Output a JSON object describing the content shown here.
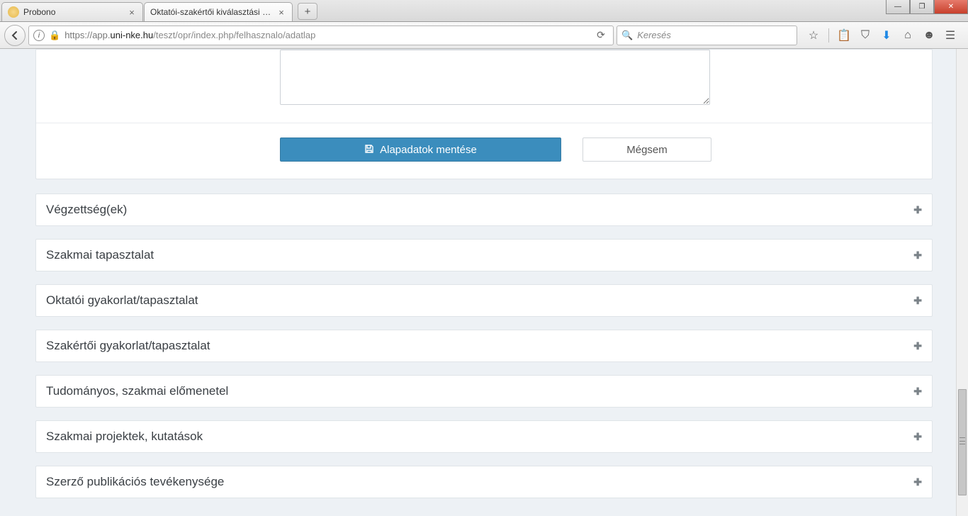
{
  "window": {
    "tabs": [
      {
        "title": "Probono",
        "favicon": "probono",
        "active": false
      },
      {
        "title": "Oktatói-szakértői kiválasztási re...",
        "favicon": "",
        "active": true
      }
    ]
  },
  "nav": {
    "url_secure_prefix": "https://app.",
    "url_domain": "uni-nke.hu",
    "url_path": "/teszt/opr/index.php/felhasznalo/adatlap",
    "search_placeholder": "Keresés"
  },
  "form": {
    "textarea_value": "",
    "save_label": "Alapadatok mentése",
    "cancel_label": "Mégsem"
  },
  "accordions": [
    {
      "label": "Végzettség(ek)"
    },
    {
      "label": "Szakmai tapasztalat"
    },
    {
      "label": "Oktatói gyakorlat/tapasztalat"
    },
    {
      "label": "Szakértői gyakorlat/tapasztalat"
    },
    {
      "label": "Tudományos, szakmai előmenetel"
    },
    {
      "label": "Szakmai projektek, kutatások"
    },
    {
      "label": "Szerző publikációs tevékenysége"
    }
  ],
  "icons": {
    "plus": "✚",
    "save": "💾"
  }
}
